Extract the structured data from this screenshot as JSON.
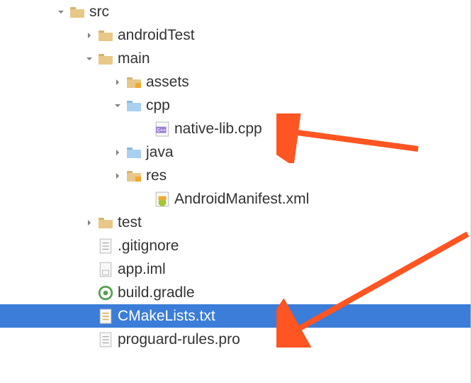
{
  "tree": {
    "src": {
      "label": "src",
      "expanded": true
    },
    "androidTest": {
      "label": "androidTest",
      "expanded": false
    },
    "main": {
      "label": "main",
      "expanded": true
    },
    "assets": {
      "label": "assets",
      "expanded": false
    },
    "cpp": {
      "label": "cpp",
      "expanded": true
    },
    "nativelib": {
      "label": "native-lib.cpp"
    },
    "java": {
      "label": "java",
      "expanded": false
    },
    "res": {
      "label": "res",
      "expanded": false
    },
    "manifest": {
      "label": "AndroidManifest.xml"
    },
    "test": {
      "label": "test",
      "expanded": false
    },
    "gitignore": {
      "label": ".gitignore"
    },
    "appiml": {
      "label": "app.iml"
    },
    "buildgradle": {
      "label": "build.gradle"
    },
    "cmakelists": {
      "label": "CMakeLists.txt",
      "selected": true
    },
    "proguard": {
      "label": "proguard-rules.pro"
    }
  }
}
